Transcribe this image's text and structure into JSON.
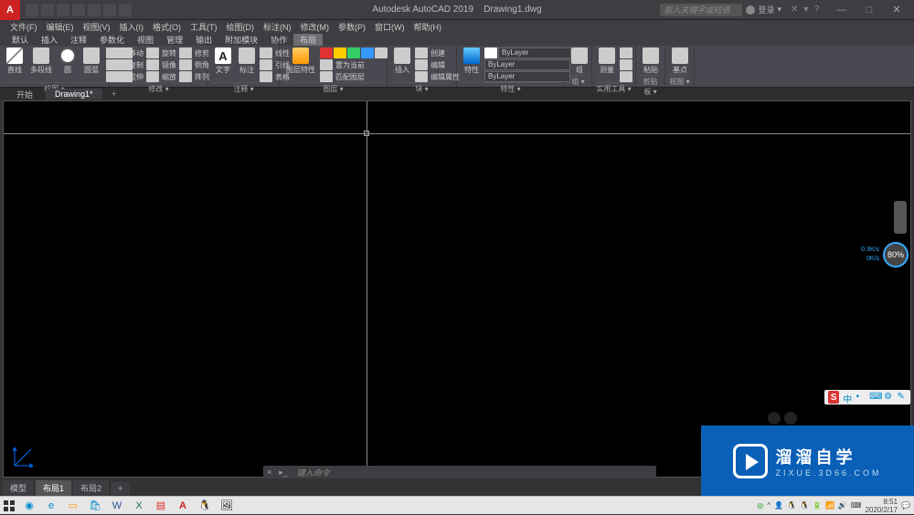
{
  "title": {
    "app": "Autodesk AutoCAD 2019",
    "file": "Drawing1.dwg"
  },
  "search": {
    "placeholder": "能入关键字或短语"
  },
  "login": {
    "label": "登录"
  },
  "window": {
    "min": "—",
    "max": "□",
    "close": "✕"
  },
  "menubar": [
    "文件(F)",
    "编辑(E)",
    "视图(V)",
    "插入(I)",
    "格式(O)",
    "工具(T)",
    "绘图(D)",
    "标注(N)",
    "修改(M)",
    "参数(P)",
    "窗口(W)",
    "帮助(H)"
  ],
  "ribbon_tabs": [
    "默认",
    "插入",
    "注释",
    "参数化",
    "视图",
    "管理",
    "输出",
    "附加模块",
    "协作",
    "布局"
  ],
  "ribbon_active": 9,
  "panels": {
    "draw": {
      "title": "绘图 ▾",
      "b1": "直线",
      "b2": "多段线",
      "b3": "圆",
      "b4": "圆弧"
    },
    "modify": {
      "title": "修改 ▾",
      "r1a": "移动",
      "r1b": "旋转",
      "r1c": "修剪",
      "r2a": "复制",
      "r2b": "镜像",
      "r2c": "倒角",
      "r3a": "拉伸",
      "r3b": "缩放",
      "r3c": "阵列"
    },
    "annot": {
      "title": "注释 ▾",
      "b1": "文字",
      "b2": "标注",
      "r1": "线性",
      "r2": "引线",
      "r3": "表格"
    },
    "layer": {
      "title": "图层 ▾",
      "b1": "图层特性",
      "r1": "置为当前",
      "r2": "匹配图层"
    },
    "block": {
      "title": "块 ▾",
      "b1": "插入",
      "r1": "创建",
      "r2": "编辑",
      "r3": "编辑属性"
    },
    "props": {
      "title": "特性 ▾",
      "b1": "特性",
      "l1": "ByLayer",
      "l2": "ByLayer",
      "l3": "ByLayer"
    },
    "groups": {
      "title": "组 ▾",
      "b1": "组"
    },
    "utils": {
      "title": "实用工具 ▾",
      "b1": "测量"
    },
    "clip": {
      "title": "剪贴板 ▾",
      "b1": "粘贴"
    },
    "view": {
      "title": "视图 ▾",
      "b1": "基点"
    }
  },
  "filetabs": {
    "t1": "开始",
    "t2": "Drawing1*"
  },
  "cmd": {
    "prompt": "键入命令"
  },
  "modeltabs": {
    "t1": "模型",
    "t2": "布局1",
    "t3": "布局2"
  },
  "speed": {
    "up": "0.3K/s",
    "down": "0K/s",
    "pct": "80%"
  },
  "watermark": {
    "l1": "溜溜自学",
    "l2": "ZIXUE.3D66.COM"
  },
  "clock": {
    "time": "8:51",
    "date": "2020/2/17"
  },
  "ime": {
    "s": "S"
  }
}
